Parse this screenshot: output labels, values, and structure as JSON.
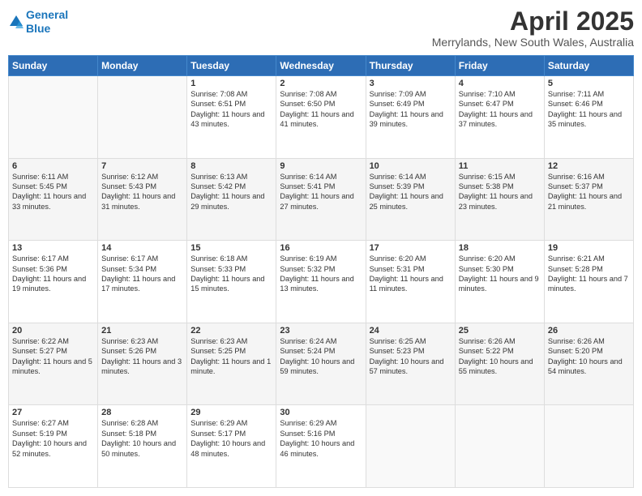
{
  "logo": {
    "line1": "General",
    "line2": "Blue"
  },
  "title": "April 2025",
  "subtitle": "Merrylands, New South Wales, Australia",
  "days_of_week": [
    "Sunday",
    "Monday",
    "Tuesday",
    "Wednesday",
    "Thursday",
    "Friday",
    "Saturday"
  ],
  "weeks": [
    [
      {
        "day": "",
        "info": ""
      },
      {
        "day": "",
        "info": ""
      },
      {
        "day": "1",
        "info": "Sunrise: 7:08 AM\nSunset: 6:51 PM\nDaylight: 11 hours and 43 minutes."
      },
      {
        "day": "2",
        "info": "Sunrise: 7:08 AM\nSunset: 6:50 PM\nDaylight: 11 hours and 41 minutes."
      },
      {
        "day": "3",
        "info": "Sunrise: 7:09 AM\nSunset: 6:49 PM\nDaylight: 11 hours and 39 minutes."
      },
      {
        "day": "4",
        "info": "Sunrise: 7:10 AM\nSunset: 6:47 PM\nDaylight: 11 hours and 37 minutes."
      },
      {
        "day": "5",
        "info": "Sunrise: 7:11 AM\nSunset: 6:46 PM\nDaylight: 11 hours and 35 minutes."
      }
    ],
    [
      {
        "day": "6",
        "info": "Sunrise: 6:11 AM\nSunset: 5:45 PM\nDaylight: 11 hours and 33 minutes."
      },
      {
        "day": "7",
        "info": "Sunrise: 6:12 AM\nSunset: 5:43 PM\nDaylight: 11 hours and 31 minutes."
      },
      {
        "day": "8",
        "info": "Sunrise: 6:13 AM\nSunset: 5:42 PM\nDaylight: 11 hours and 29 minutes."
      },
      {
        "day": "9",
        "info": "Sunrise: 6:14 AM\nSunset: 5:41 PM\nDaylight: 11 hours and 27 minutes."
      },
      {
        "day": "10",
        "info": "Sunrise: 6:14 AM\nSunset: 5:39 PM\nDaylight: 11 hours and 25 minutes."
      },
      {
        "day": "11",
        "info": "Sunrise: 6:15 AM\nSunset: 5:38 PM\nDaylight: 11 hours and 23 minutes."
      },
      {
        "day": "12",
        "info": "Sunrise: 6:16 AM\nSunset: 5:37 PM\nDaylight: 11 hours and 21 minutes."
      }
    ],
    [
      {
        "day": "13",
        "info": "Sunrise: 6:17 AM\nSunset: 5:36 PM\nDaylight: 11 hours and 19 minutes."
      },
      {
        "day": "14",
        "info": "Sunrise: 6:17 AM\nSunset: 5:34 PM\nDaylight: 11 hours and 17 minutes."
      },
      {
        "day": "15",
        "info": "Sunrise: 6:18 AM\nSunset: 5:33 PM\nDaylight: 11 hours and 15 minutes."
      },
      {
        "day": "16",
        "info": "Sunrise: 6:19 AM\nSunset: 5:32 PM\nDaylight: 11 hours and 13 minutes."
      },
      {
        "day": "17",
        "info": "Sunrise: 6:20 AM\nSunset: 5:31 PM\nDaylight: 11 hours and 11 minutes."
      },
      {
        "day": "18",
        "info": "Sunrise: 6:20 AM\nSunset: 5:30 PM\nDaylight: 11 hours and 9 minutes."
      },
      {
        "day": "19",
        "info": "Sunrise: 6:21 AM\nSunset: 5:28 PM\nDaylight: 11 hours and 7 minutes."
      }
    ],
    [
      {
        "day": "20",
        "info": "Sunrise: 6:22 AM\nSunset: 5:27 PM\nDaylight: 11 hours and 5 minutes."
      },
      {
        "day": "21",
        "info": "Sunrise: 6:23 AM\nSunset: 5:26 PM\nDaylight: 11 hours and 3 minutes."
      },
      {
        "day": "22",
        "info": "Sunrise: 6:23 AM\nSunset: 5:25 PM\nDaylight: 11 hours and 1 minute."
      },
      {
        "day": "23",
        "info": "Sunrise: 6:24 AM\nSunset: 5:24 PM\nDaylight: 10 hours and 59 minutes."
      },
      {
        "day": "24",
        "info": "Sunrise: 6:25 AM\nSunset: 5:23 PM\nDaylight: 10 hours and 57 minutes."
      },
      {
        "day": "25",
        "info": "Sunrise: 6:26 AM\nSunset: 5:22 PM\nDaylight: 10 hours and 55 minutes."
      },
      {
        "day": "26",
        "info": "Sunrise: 6:26 AM\nSunset: 5:20 PM\nDaylight: 10 hours and 54 minutes."
      }
    ],
    [
      {
        "day": "27",
        "info": "Sunrise: 6:27 AM\nSunset: 5:19 PM\nDaylight: 10 hours and 52 minutes."
      },
      {
        "day": "28",
        "info": "Sunrise: 6:28 AM\nSunset: 5:18 PM\nDaylight: 10 hours and 50 minutes."
      },
      {
        "day": "29",
        "info": "Sunrise: 6:29 AM\nSunset: 5:17 PM\nDaylight: 10 hours and 48 minutes."
      },
      {
        "day": "30",
        "info": "Sunrise: 6:29 AM\nSunset: 5:16 PM\nDaylight: 10 hours and 46 minutes."
      },
      {
        "day": "",
        "info": ""
      },
      {
        "day": "",
        "info": ""
      },
      {
        "day": "",
        "info": ""
      }
    ]
  ]
}
